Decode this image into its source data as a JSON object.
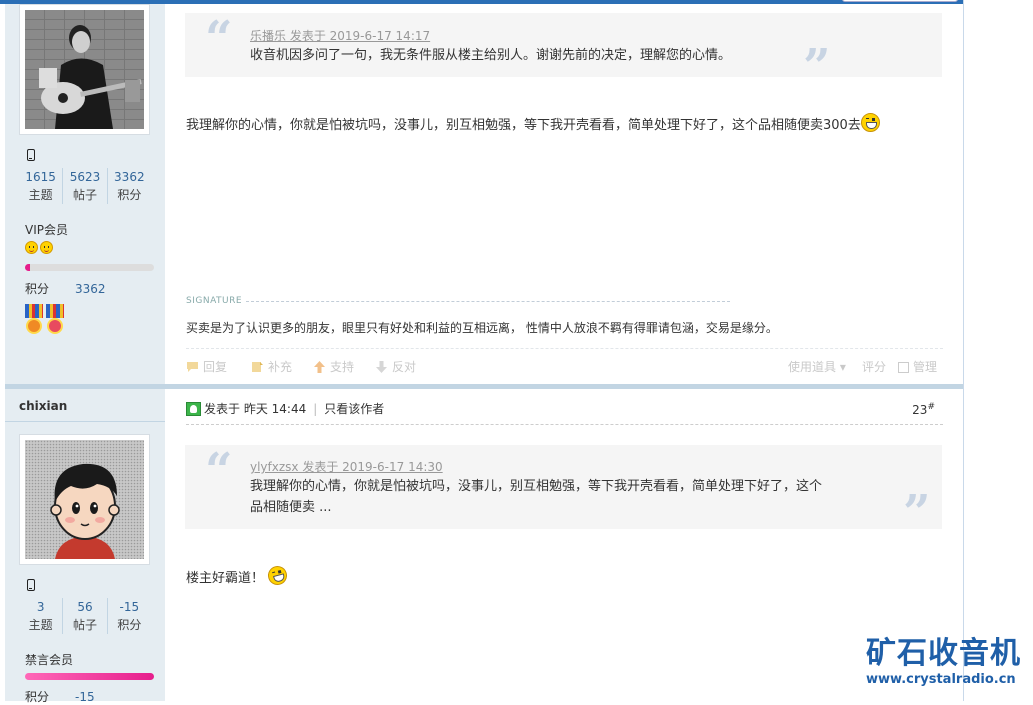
{
  "colors": {
    "brand_blue": "#2b6fb6",
    "link_blue": "#336699",
    "vip_pink": "#e61e8c",
    "sidebar_bg": "#e5edf2",
    "watermark_blue": "#1f5fa8"
  },
  "post1": {
    "author": {
      "stats": [
        {
          "value": "1615",
          "label": "主题"
        },
        {
          "value": "5623",
          "label": "帖子"
        },
        {
          "value": "3362",
          "label": "积分"
        }
      ],
      "group": "VIP会员",
      "group_progress_percent": 4,
      "points_label": "积分",
      "points_value": "3362",
      "medals": [
        "medal-icon",
        "medal-icon"
      ]
    },
    "quote": {
      "header": "乐播乐 发表于 2019-6-17 14:17",
      "text": "收音机因多问了一句，我无条件服从楼主给别人。谢谢先前的决定，理解您的心情。"
    },
    "message": "我理解你的心情，你就是怕被坑吗，没事儿，别互相勉强，等下我开壳看看，简单处理下好了，这个品相随便卖300去",
    "message_emoji": "grin-emoji-icon",
    "signature_label": "SIGNATURE",
    "signature": "买卖是为了认识更多的朋友，眼里只有好处和利益的互相远离， 性情中人放浪不羁有得罪请包涵，交易是缘分。",
    "actions": {
      "reply": "回复",
      "supplement": "补充",
      "support": "支持",
      "oppose": "反对",
      "use_tool": "使用道具",
      "rate": "评分",
      "manage": "管理"
    }
  },
  "post2": {
    "author": {
      "username": "chixian",
      "stats": [
        {
          "value": "3",
          "label": "主题"
        },
        {
          "value": "56",
          "label": "帖子"
        },
        {
          "value": "-15",
          "label": "积分"
        }
      ],
      "group": "禁言会员",
      "points_label": "积分",
      "points_value": "-15"
    },
    "header": {
      "posted": "发表于 昨天 14:44",
      "only_author": "只看该作者",
      "floor_number": "23",
      "floor_mark": "#"
    },
    "quote": {
      "header": "ylyfxzsx 发表于 2019-6-17 14:30",
      "line1": "我理解你的心情，你就是怕被坑吗，没事儿，别互相勉强，等下我开壳看看，简单处理下好了，这个",
      "line2": "品相随便卖 ..."
    },
    "message": "楼主好霸道！",
    "message_emoji": "wink-emoji-icon"
  },
  "watermark": {
    "cn": "矿石收音机",
    "url": "www.crystalradio.cn"
  }
}
